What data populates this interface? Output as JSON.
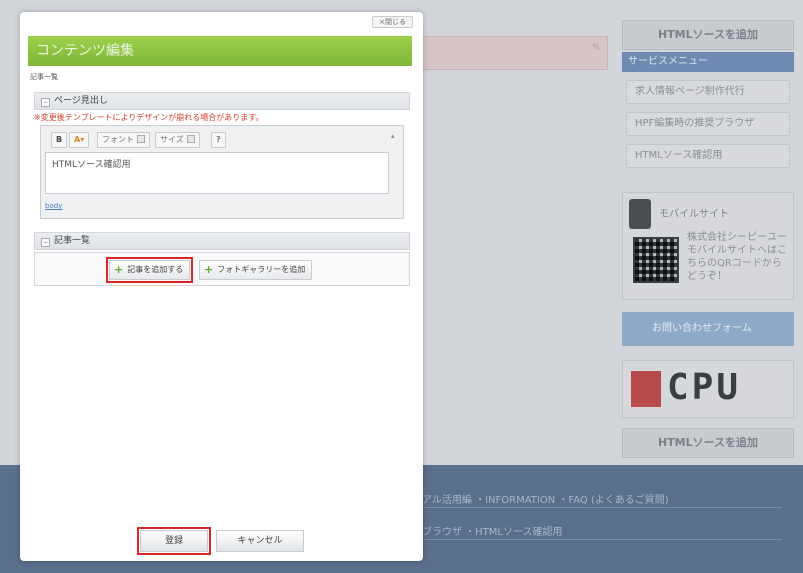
{
  "modal": {
    "close_label": "×閉じる",
    "title": "コンテンツ編集",
    "breadcrumb": "記事一覧",
    "section_heading": "ページ見出し",
    "template_warning": "※変更後テンプレートによりデザインが崩れる場合があります。",
    "editor": {
      "bold_label": "B",
      "color_label": "A",
      "font_label": "フォント",
      "size_label": "サイズ",
      "help_label": "?",
      "content": "HTMLソース確認用",
      "footer_link": "body"
    },
    "list_heading": "記事一覧",
    "add_article_label": "記事を追加する",
    "add_gallery_label": "フォトギャラリーを追加",
    "register_label": "登録",
    "cancel_label": "キャンセル"
  },
  "background": {
    "sidebar_heading_top": "HTMLソースを追加",
    "service_menu": "サービスメニュー",
    "menu_items": [
      "求人情報ページ制作代行",
      "HPF編集時の推奨ブラウザ",
      "HTMLソース確認用"
    ],
    "mobile_title": "モバイルサイト",
    "mobile_desc": "株式会社シーピーユーモバイルサイトへはこちらのQRコードからどうぞ！",
    "contact_label": "お問い合わせフォーム",
    "logo_text": "CPU",
    "sidebar_heading_bottom": "HTMLソースを追加",
    "footer_line1": "アル活用編 ・INFORMATION ・FAQ (よくあるご質問)",
    "footer_line2": "ブラウザ ・HTMLソース確認用"
  },
  "icons": [
    "pencil-icon",
    "plus-icon",
    "toggle-icon",
    "phone-icon",
    "qr-code-icon",
    "mail-icon",
    "dropdown-icon"
  ],
  "colors": {
    "header_green": "#8cc444",
    "highlight_red": "#d62828",
    "footer_blue": "#5a6f8c",
    "warning_red": "#d8402c"
  }
}
